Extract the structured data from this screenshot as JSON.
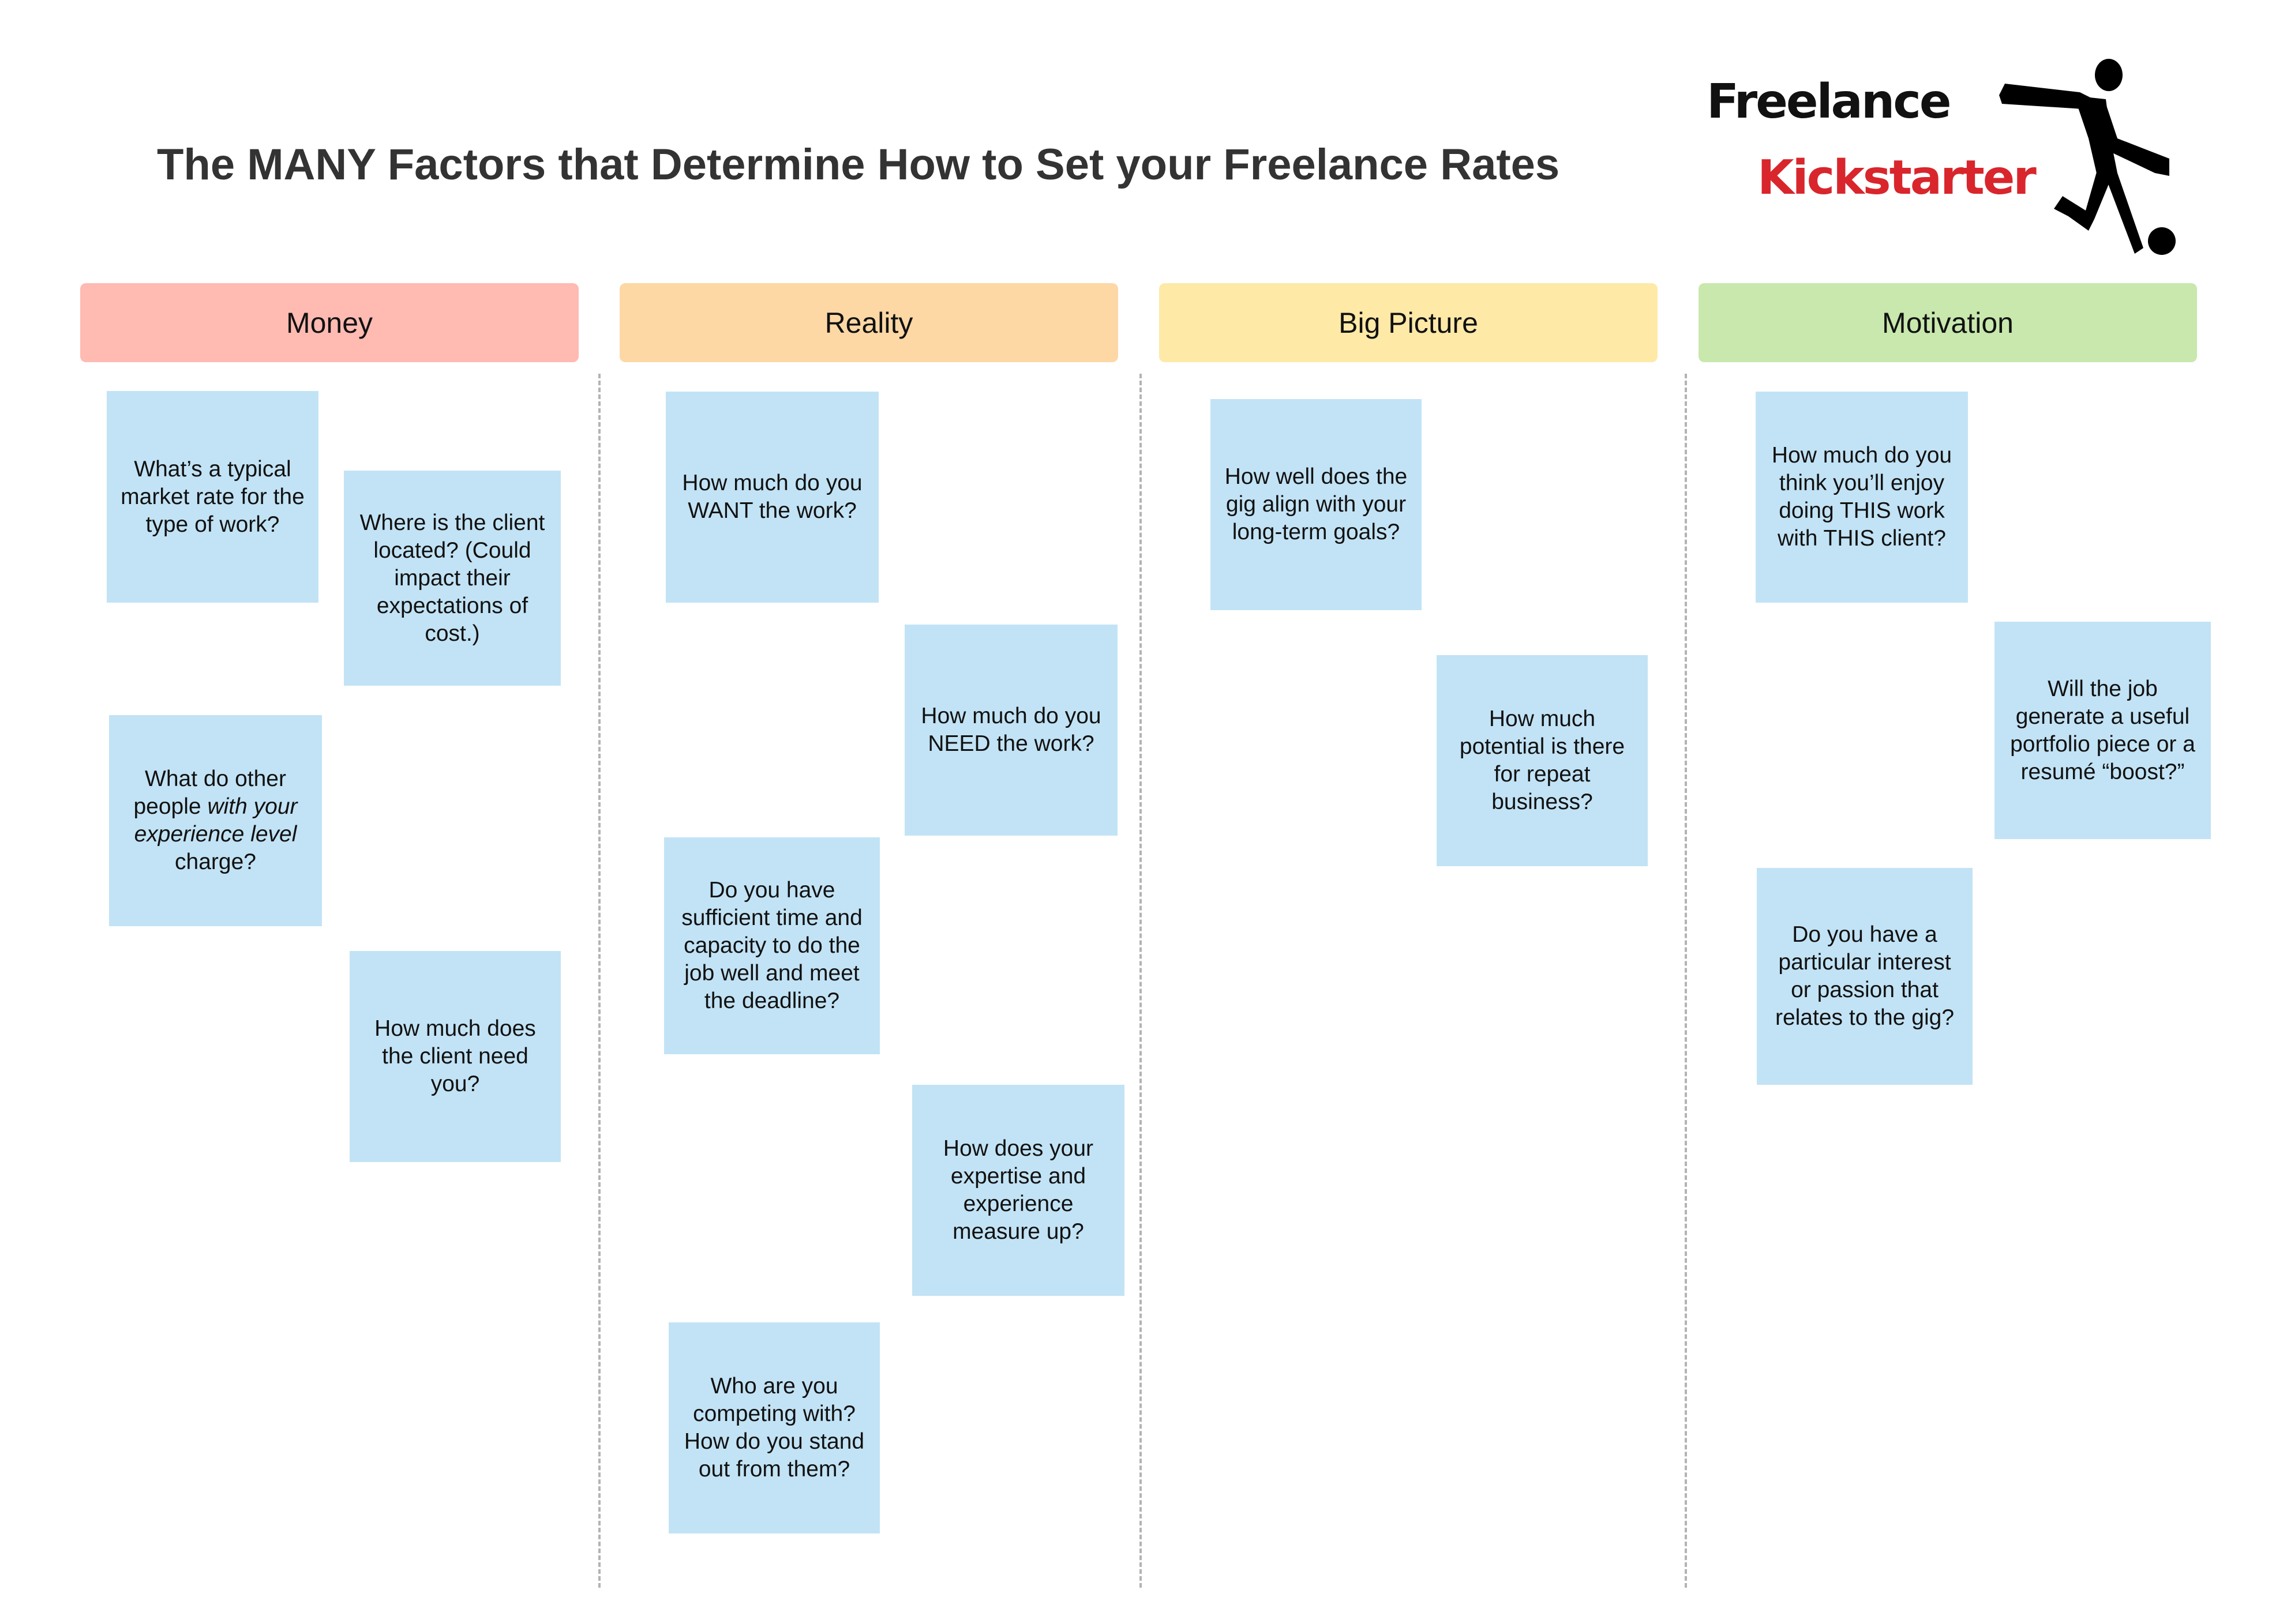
{
  "title": "The MANY Factors that Determine How to Set your Freelance Rates",
  "logo": {
    "line1": "Freelance",
    "line2": "Kickstarter",
    "line2_color": "#d8262c",
    "icon": "soccer-player-kicking-ball-icon"
  },
  "colors": {
    "note_fill": "#c2e3f5",
    "divider": "#b3b3b3"
  },
  "columns": [
    {
      "label": "Money",
      "color": "#ffbab2",
      "notes": [
        {
          "text": "What’s a typical market rate for the type of work?"
        },
        {
          "text": "Where is the client located? (Could impact their expectations of cost.)"
        },
        {
          "text_before": "What do other people ",
          "text_italic": "with your experience level",
          "text_after": " charge?"
        },
        {
          "text": "How much does the client need you?"
        }
      ]
    },
    {
      "label": "Reality",
      "color": "#fdd8a5",
      "notes": [
        {
          "text": "How much do you WANT the work?"
        },
        {
          "text": "How much do you NEED the work?"
        },
        {
          "text": "Do you have sufficient time and capacity to do the job well and meet the deadline?"
        },
        {
          "text": "How does your expertise and experience measure up?"
        },
        {
          "text": "Who are you competing with? How do you stand out from them?"
        }
      ]
    },
    {
      "label": "Big Picture",
      "color": "#fee9a7",
      "notes": [
        {
          "text": "How well does the gig align with your long-term goals?"
        },
        {
          "text": "How much potential is there for repeat business?"
        }
      ]
    },
    {
      "label": "Motivation",
      "color": "#c8e8ad",
      "notes": [
        {
          "text": "How much do you think you’ll enjoy doing THIS work with THIS client?"
        },
        {
          "text": "Will the job generate a useful portfolio piece or a resumé “boost?”"
        },
        {
          "text": "Do you have a particular interest or passion that relates to the gig?"
        }
      ]
    }
  ]
}
